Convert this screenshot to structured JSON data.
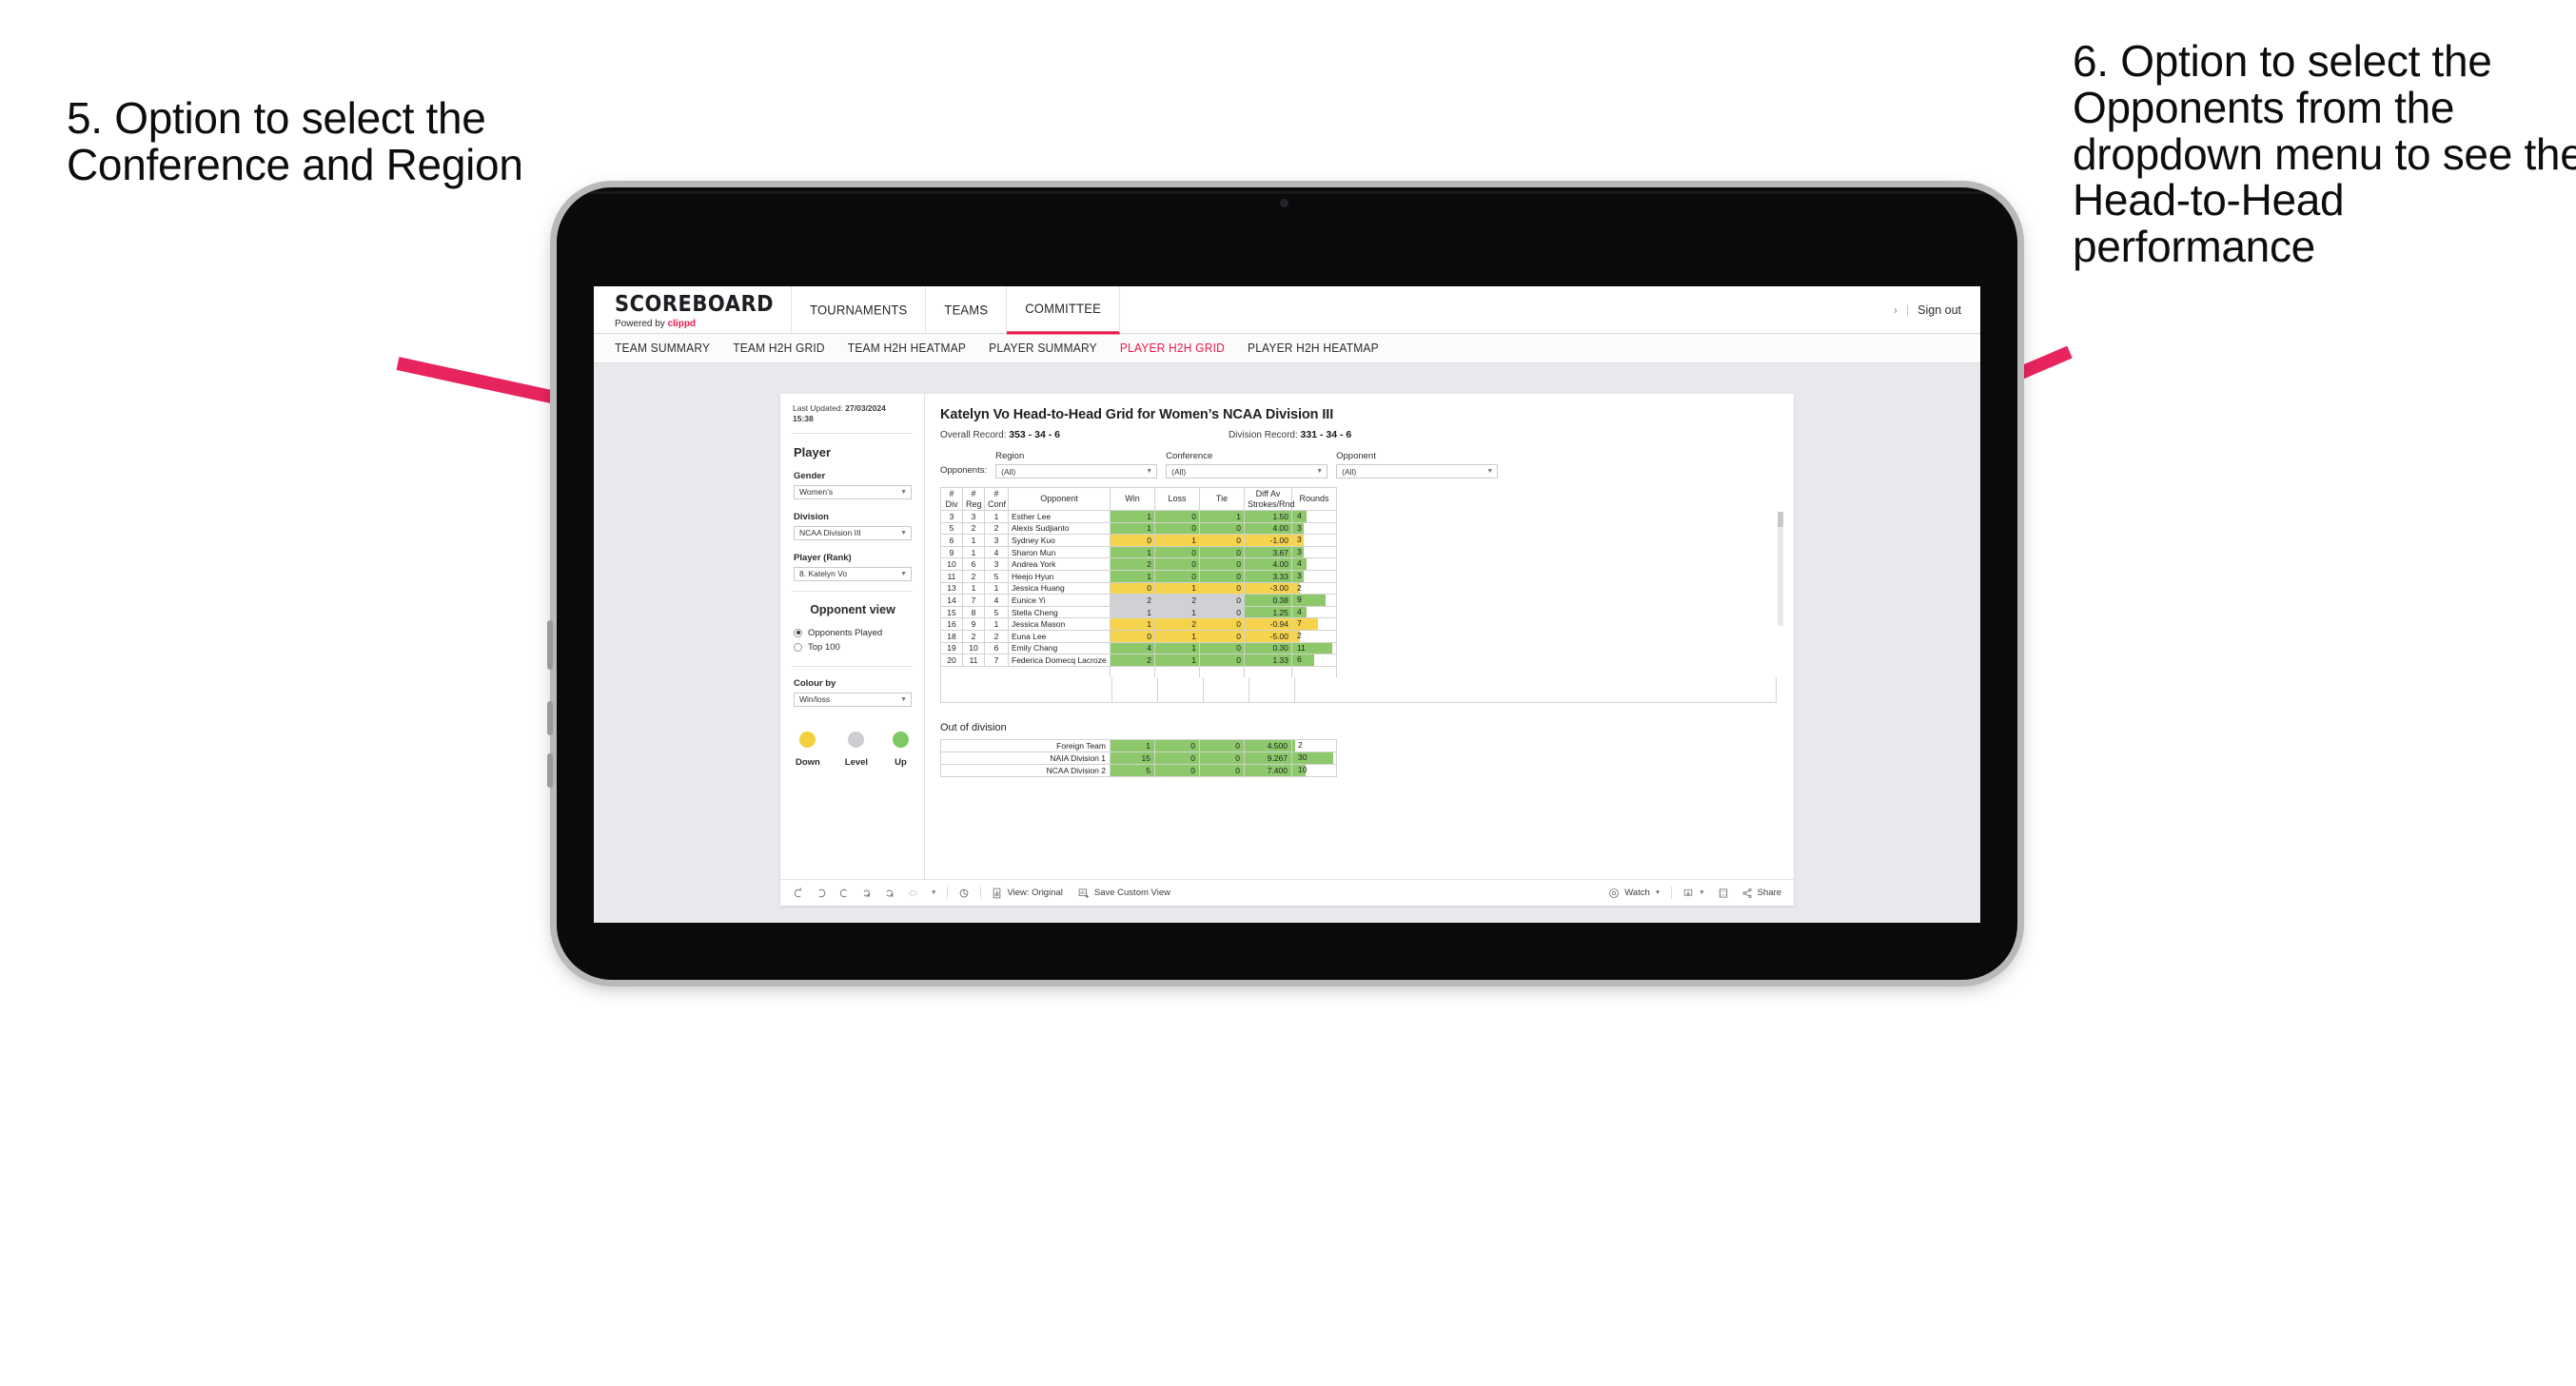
{
  "annotations": {
    "left": "5. Option to select the Conference and Region",
    "right": "6. Option to select the Opponents from the dropdown menu to see the Head-to-Head performance"
  },
  "app": {
    "brand": {
      "title": "SCOREBOARD",
      "powered_prefix": "Powered by ",
      "powered_name": "clippd"
    },
    "topnav": [
      {
        "label": "TOURNAMENTS",
        "active": false
      },
      {
        "label": "TEAMS",
        "active": false
      },
      {
        "label": "COMMITTEE",
        "active": true
      }
    ],
    "signout": {
      "chevron": "›",
      "divider": "|",
      "label": "Sign out"
    },
    "subnav": [
      {
        "label": "TEAM SUMMARY",
        "active": false
      },
      {
        "label": "TEAM H2H GRID",
        "active": false
      },
      {
        "label": "TEAM H2H HEATMAP",
        "active": false
      },
      {
        "label": "PLAYER SUMMARY",
        "active": false
      },
      {
        "label": "PLAYER H2H GRID",
        "active": true
      },
      {
        "label": "PLAYER H2H HEATMAP",
        "active": false
      }
    ]
  },
  "sidebar": {
    "last_updated_label": "Last Updated: ",
    "last_updated_value": "27/03/2024",
    "last_updated_time": "15:38",
    "player_heading": "Player",
    "gender": {
      "label": "Gender",
      "value": "Women’s"
    },
    "division": {
      "label": "Division",
      "value": "NCAA Division III"
    },
    "player_rank": {
      "label": "Player (Rank)",
      "value": "8. Katelyn Vo"
    },
    "opponent_view": {
      "heading": "Opponent view",
      "options": [
        {
          "label": "Opponents Played",
          "selected": true
        },
        {
          "label": "Top 100",
          "selected": false
        }
      ]
    },
    "colour_by": {
      "label": "Colour by",
      "value": "Win/loss"
    },
    "legend": [
      {
        "label": "Down",
        "color": "#F2D13D"
      },
      {
        "label": "Level",
        "color": "#CBCDD2"
      },
      {
        "label": "Up",
        "color": "#7DC963"
      }
    ]
  },
  "main": {
    "title": "Katelyn Vo Head-to-Head Grid for Women’s NCAA Division III",
    "overall_record_label": "Overall Record: ",
    "overall_record_value": "353 - 34 - 6",
    "division_record_label": "Division Record: ",
    "division_record_value": "331 -  34 - 6",
    "opponents_label": "Opponents:",
    "filters": [
      {
        "name": "region",
        "label": "Region",
        "value": "(All)"
      },
      {
        "name": "conference",
        "label": "Conference",
        "value": "(All)"
      },
      {
        "name": "opponent",
        "label": "Opponent",
        "value": "(All)"
      }
    ],
    "out_of_division_title": "Out of division"
  },
  "chart_data": {
    "type": "table",
    "title": "Katelyn Vo Head-to-Head Grid for Women’s NCAA Division III",
    "columns": [
      "# Div",
      "# Reg",
      "# Conf",
      "Opponent",
      "Win",
      "Loss",
      "Tie",
      "Diff Av Strokes/Rnd",
      "Rounds"
    ],
    "column_headers_two_line": [
      [
        "#",
        "Div"
      ],
      [
        "#",
        "Reg"
      ],
      [
        "#",
        "Conf"
      ],
      [
        "Opponent",
        ""
      ],
      [
        "Win",
        ""
      ],
      [
        "Loss",
        ""
      ],
      [
        "Tie",
        ""
      ],
      [
        "Diff Av",
        "Strokes/Rnd"
      ],
      [
        "Rounds",
        ""
      ]
    ],
    "rounds_max": 12,
    "rows": [
      {
        "div": "3",
        "reg": "3",
        "conf": "1",
        "opponent": "Esther Lee",
        "win": "1",
        "loss": "0",
        "tie": "1",
        "diff": "1.50",
        "rounds": "4",
        "color": "g"
      },
      {
        "div": "5",
        "reg": "2",
        "conf": "2",
        "opponent": "Alexis Sudjianto",
        "win": "1",
        "loss": "0",
        "tie": "0",
        "diff": "4.00",
        "rounds": "3",
        "color": "g"
      },
      {
        "div": "6",
        "reg": "1",
        "conf": "3",
        "opponent": "Sydney Kuo",
        "win": "0",
        "loss": "1",
        "tie": "0",
        "diff": "-1.00",
        "rounds": "3",
        "color": "y"
      },
      {
        "div": "9",
        "reg": "1",
        "conf": "4",
        "opponent": "Sharon Mun",
        "win": "1",
        "loss": "0",
        "tie": "0",
        "diff": "3.67",
        "rounds": "3",
        "color": "g"
      },
      {
        "div": "10",
        "reg": "6",
        "conf": "3",
        "opponent": "Andrea York",
        "win": "2",
        "loss": "0",
        "tie": "0",
        "diff": "4.00",
        "rounds": "4",
        "color": "g"
      },
      {
        "div": "11",
        "reg": "2",
        "conf": "5",
        "opponent": "Heejo Hyun",
        "win": "1",
        "loss": "0",
        "tie": "0",
        "diff": "3.33",
        "rounds": "3",
        "color": "g"
      },
      {
        "div": "13",
        "reg": "1",
        "conf": "1",
        "opponent": "Jessica Huang",
        "win": "0",
        "loss": "1",
        "tie": "0",
        "diff": "-3.00",
        "rounds": "2",
        "color": "y"
      },
      {
        "div": "14",
        "reg": "7",
        "conf": "4",
        "opponent": "Eunice Yi",
        "win": "2",
        "loss": "2",
        "tie": "0",
        "diff": "0.38",
        "rounds": "9",
        "color": "gr",
        "diff_color": "g"
      },
      {
        "div": "15",
        "reg": "8",
        "conf": "5",
        "opponent": "Stella Cheng",
        "win": "1",
        "loss": "1",
        "tie": "0",
        "diff": "1.25",
        "rounds": "4",
        "color": "gr",
        "diff_color": "g"
      },
      {
        "div": "16",
        "reg": "9",
        "conf": "1",
        "opponent": "Jessica Mason",
        "win": "1",
        "loss": "2",
        "tie": "0",
        "diff": "-0.94",
        "rounds": "7",
        "color": "y"
      },
      {
        "div": "18",
        "reg": "2",
        "conf": "2",
        "opponent": "Euna Lee",
        "win": "0",
        "loss": "1",
        "tie": "0",
        "diff": "-5.00",
        "rounds": "2",
        "color": "y"
      },
      {
        "div": "19",
        "reg": "10",
        "conf": "6",
        "opponent": "Emily Chang",
        "win": "4",
        "loss": "1",
        "tie": "0",
        "diff": "0.30",
        "rounds": "11",
        "color": "g"
      },
      {
        "div": "20",
        "reg": "11",
        "conf": "7",
        "opponent": "Federica Domecq Lacroze",
        "win": "2",
        "loss": "1",
        "tie": "0",
        "diff": "1.33",
        "rounds": "6",
        "color": "g"
      }
    ],
    "out_of_division": {
      "rounds_max": 32,
      "rows": [
        {
          "label": "Foreign Team",
          "win": "1",
          "loss": "0",
          "tie": "0",
          "diff": "4.500",
          "rounds": "2",
          "color": "g"
        },
        {
          "label": "NAIA Division 1",
          "win": "15",
          "loss": "0",
          "tie": "0",
          "diff": "9.267",
          "rounds": "30",
          "color": "g"
        },
        {
          "label": "NCAA Division 2",
          "win": "5",
          "loss": "0",
          "tie": "0",
          "diff": "7.400",
          "rounds": "10",
          "color": "g"
        }
      ]
    }
  },
  "toolbar": {
    "view_label": "View: Original",
    "save_label": "Save Custom View",
    "watch_label": "Watch",
    "share_label": "Share"
  },
  "colors": {
    "accent": "#E8194B",
    "green": "#8DC96A",
    "yellow": "#F5D34C",
    "grey": "#CFD1D4",
    "arrow": "#E8245F"
  }
}
